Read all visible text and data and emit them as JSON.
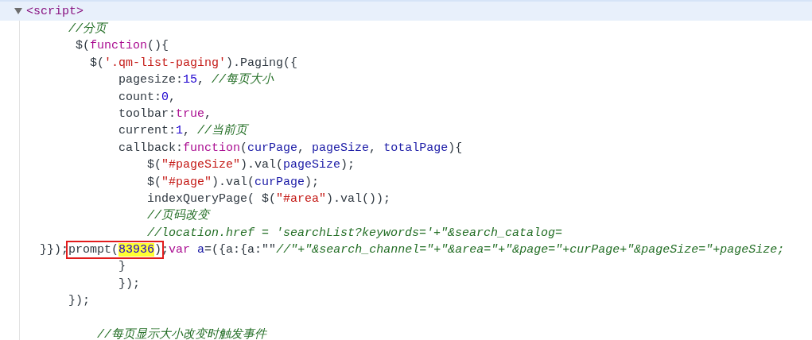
{
  "element": {
    "tag": "<script>",
    "expanded": true
  },
  "lines": [
    {
      "tokens": [
        {
          "kind": "comment",
          "text": "    //分页"
        }
      ]
    },
    {
      "tokens": [
        {
          "kind": "plain",
          "text": "     $("
        },
        {
          "kind": "keyword",
          "text": "function"
        },
        {
          "kind": "plain",
          "text": "(){"
        }
      ]
    },
    {
      "tokens": [
        {
          "kind": "plain",
          "text": "       $("
        },
        {
          "kind": "string",
          "text": "'.qm-list-paging'"
        },
        {
          "kind": "plain",
          "text": ").Paging({"
        }
      ]
    },
    {
      "tokens": [
        {
          "kind": "plain",
          "text": "           pagesize:"
        },
        {
          "kind": "number",
          "text": "15"
        },
        {
          "kind": "plain",
          "text": ", "
        },
        {
          "kind": "comment",
          "text": "//每页大小"
        }
      ]
    },
    {
      "tokens": [
        {
          "kind": "plain",
          "text": "           count:"
        },
        {
          "kind": "number",
          "text": "0"
        },
        {
          "kind": "plain",
          "text": ","
        }
      ]
    },
    {
      "tokens": [
        {
          "kind": "plain",
          "text": "           toolbar:"
        },
        {
          "kind": "keyword",
          "text": "true"
        },
        {
          "kind": "plain",
          "text": ","
        }
      ]
    },
    {
      "tokens": [
        {
          "kind": "plain",
          "text": "           current:"
        },
        {
          "kind": "number",
          "text": "1"
        },
        {
          "kind": "plain",
          "text": ", "
        },
        {
          "kind": "comment",
          "text": "//当前页"
        }
      ]
    },
    {
      "tokens": [
        {
          "kind": "plain",
          "text": "           callback:"
        },
        {
          "kind": "keyword",
          "text": "function"
        },
        {
          "kind": "plain",
          "text": "("
        },
        {
          "kind": "variable",
          "text": "curPage"
        },
        {
          "kind": "plain",
          "text": ", "
        },
        {
          "kind": "variable",
          "text": "pageSize"
        },
        {
          "kind": "plain",
          "text": ", "
        },
        {
          "kind": "variable",
          "text": "totalPage"
        },
        {
          "kind": "plain",
          "text": "){"
        }
      ]
    },
    {
      "tokens": [
        {
          "kind": "plain",
          "text": "               $("
        },
        {
          "kind": "string",
          "text": "\"#pageSize\""
        },
        {
          "kind": "plain",
          "text": ").val("
        },
        {
          "kind": "variable",
          "text": "pageSize"
        },
        {
          "kind": "plain",
          "text": ");"
        }
      ]
    },
    {
      "tokens": [
        {
          "kind": "plain",
          "text": "               $("
        },
        {
          "kind": "string",
          "text": "\"#page\""
        },
        {
          "kind": "plain",
          "text": ").val("
        },
        {
          "kind": "variable",
          "text": "curPage"
        },
        {
          "kind": "plain",
          "text": ");"
        }
      ]
    },
    {
      "tokens": [
        {
          "kind": "plain",
          "text": "               indexQueryPage( $("
        },
        {
          "kind": "string",
          "text": "\"#area\""
        },
        {
          "kind": "plain",
          "text": ").val());"
        }
      ]
    },
    {
      "tokens": [
        {
          "kind": "comment",
          "text": "               //页码改变"
        }
      ]
    },
    {
      "tokens": [
        {
          "kind": "comment",
          "text": "               //location.href = 'searchList?keywords='+\"&search_catalog="
        }
      ]
    },
    {
      "tokens": [
        {
          "kind": "plain",
          "text": "}});"
        },
        {
          "kind": "plain",
          "text": "prompt(",
          "boxed": true
        },
        {
          "kind": "number",
          "text": "83936",
          "boxed": true,
          "highlighted": true
        },
        {
          "kind": "plain",
          "text": ")",
          "boxed": true
        },
        {
          "kind": "plain",
          "text": ";"
        },
        {
          "kind": "keyword",
          "text": "var "
        },
        {
          "kind": "variable",
          "text": "a"
        },
        {
          "kind": "plain",
          "text": "=({a:{a:\"\""
        },
        {
          "kind": "comment",
          "text": "//\"+\"&search_channel=\"+\"&area=\"+\"&page=\"+curPage+\"&pageSize=\"+pageSize;"
        }
      ]
    },
    {
      "tokens": [
        {
          "kind": "plain",
          "text": "           }"
        }
      ]
    },
    {
      "tokens": [
        {
          "kind": "plain",
          "text": "           });"
        }
      ]
    },
    {
      "tokens": [
        {
          "kind": "plain",
          "text": "    });"
        }
      ]
    },
    {
      "blank_line_before": true,
      "tokens": [
        {
          "kind": "comment",
          "text": "        //每页显示大小改变时触发事件"
        }
      ]
    }
  ]
}
